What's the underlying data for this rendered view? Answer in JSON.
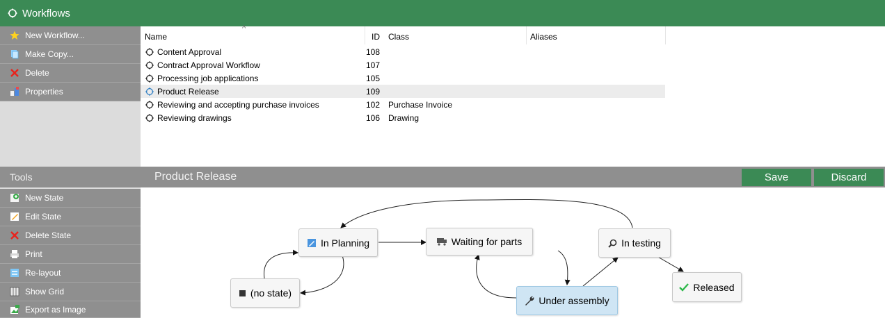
{
  "window": {
    "title": "Workflows"
  },
  "sidebar": {
    "actions": [
      {
        "label": "New Workflow...",
        "icon": "star-icon"
      },
      {
        "label": "Make Copy...",
        "icon": "copy-icon"
      },
      {
        "label": "Delete",
        "icon": "delete-x-icon"
      },
      {
        "label": "Properties",
        "icon": "properties-icon"
      }
    ],
    "tools_header": "Tools",
    "tools": [
      {
        "label": "New State",
        "icon": "new-state-icon"
      },
      {
        "label": "Edit State",
        "icon": "edit-state-icon"
      },
      {
        "label": "Delete State",
        "icon": "delete-x-icon"
      },
      {
        "label": "Print",
        "icon": "printer-icon"
      },
      {
        "label": "Re-layout",
        "icon": "relayout-icon"
      },
      {
        "label": "Show Grid",
        "icon": "grid-icon"
      },
      {
        "label": "Export as Image",
        "icon": "export-image-icon"
      }
    ]
  },
  "table": {
    "columns": {
      "name": "Name",
      "id": "ID",
      "class": "Class",
      "aliases": "Aliases"
    },
    "sort_indicator": "^",
    "rows": [
      {
        "name": "Content Approval",
        "id": "108",
        "class": "",
        "aliases": ""
      },
      {
        "name": "Contract Approval Workflow",
        "id": "107",
        "class": "",
        "aliases": ""
      },
      {
        "name": "Processing job applications",
        "id": "105",
        "class": "",
        "aliases": ""
      },
      {
        "name": "Product Release",
        "id": "109",
        "class": "",
        "aliases": "",
        "selected": true
      },
      {
        "name": "Reviewing and accepting purchase invoices",
        "id": "102",
        "class": "Purchase Invoice",
        "aliases": ""
      },
      {
        "name": "Reviewing drawings",
        "id": "106",
        "class": "Drawing",
        "aliases": ""
      }
    ]
  },
  "editor": {
    "title": "Product Release",
    "save_label": "Save",
    "discard_label": "Discard",
    "states": {
      "no_state": {
        "label": "(no state)",
        "icon": "square-icon"
      },
      "in_planning": {
        "label": "In Planning",
        "icon": "pencil-icon"
      },
      "waiting_for_parts": {
        "label": "Waiting for parts",
        "icon": "truck-icon"
      },
      "under_assembly": {
        "label": "Under assembly",
        "icon": "wrench-icon"
      },
      "in_testing": {
        "label": "In testing",
        "icon": "magnifier-icon"
      },
      "released": {
        "label": "Released",
        "icon": "checkmark-icon"
      }
    }
  },
  "colors": {
    "accent_green": "#3b8a55",
    "panel_gray": "#8f8f8f",
    "selected_state_blue": "#cfe5f4"
  }
}
